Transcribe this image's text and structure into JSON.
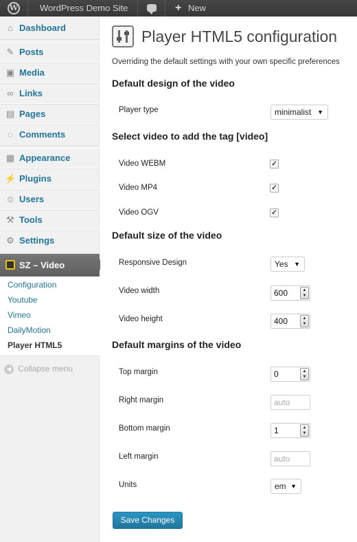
{
  "adminbar": {
    "site_name": "WordPress Demo Site",
    "new_label": "New",
    "icons": [
      "wordpress-logo-icon",
      "comment-bubble-icon",
      "plus-icon"
    ]
  },
  "sidebar": {
    "items": [
      {
        "label": "Dashboard",
        "icon": "home-icon"
      },
      {
        "label": "Posts",
        "icon": "pin-icon"
      },
      {
        "label": "Media",
        "icon": "camera-icon"
      },
      {
        "label": "Links",
        "icon": "link-icon"
      },
      {
        "label": "Pages",
        "icon": "pages-icon"
      },
      {
        "label": "Comments",
        "icon": "comment-icon"
      },
      {
        "label": "Appearance",
        "icon": "appearance-icon"
      },
      {
        "label": "Plugins",
        "icon": "plug-icon"
      },
      {
        "label": "Users",
        "icon": "users-icon"
      },
      {
        "label": "Tools",
        "icon": "tools-icon"
      },
      {
        "label": "Settings",
        "icon": "settings-icon"
      }
    ],
    "current": {
      "label": "SZ – Video",
      "icon": "video-plugin-icon"
    },
    "submenu": [
      "Configuration",
      "Youtube",
      "Vimeo",
      "DailyMotion",
      "Player HTML5"
    ],
    "collapse_label": "Collapse menu"
  },
  "main": {
    "title": "Player HTML5 configuration",
    "intro": "Overriding the default settings with your own specific preferences",
    "sections": {
      "design": {
        "title": "Default design of the video",
        "player_type_label": "Player type",
        "player_type_value": "minimalist"
      },
      "tags": {
        "title": "Select video to add the tag [video]",
        "options": [
          {
            "label": "Video WEBM",
            "checked": true
          },
          {
            "label": "Video MP4",
            "checked": true
          },
          {
            "label": "Video OGV",
            "checked": true
          }
        ]
      },
      "size": {
        "title": "Default size of the video",
        "responsive_label": "Responsive Design",
        "responsive_value": "Yes",
        "width_label": "Video width",
        "width_value": "600",
        "height_label": "Video height",
        "height_value": "400"
      },
      "margins": {
        "title": "Default margins of the video",
        "top_label": "Top margin",
        "top_value": "0",
        "right_label": "Right margin",
        "right_placeholder": "auto",
        "bottom_label": "Bottom margin",
        "bottom_value": "1",
        "left_label": "Left margin",
        "left_placeholder": "auto",
        "units_label": "Units",
        "units_value": "em"
      }
    },
    "save_label": "Save Changes"
  },
  "colors": {
    "link": "#21759b",
    "adminbar": "#464646",
    "current_menu": "#6a6a6a",
    "button": "#21759b"
  }
}
